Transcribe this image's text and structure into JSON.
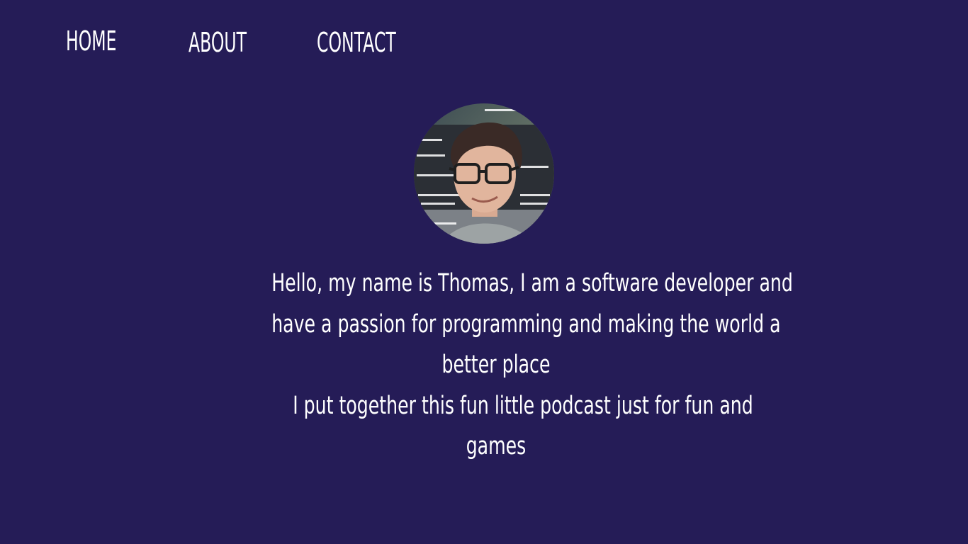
{
  "nav": {
    "items": [
      {
        "label": "HOME"
      },
      {
        "label": "ABOUT"
      },
      {
        "label": "CONTACT"
      }
    ]
  },
  "profile": {
    "photo_icon": "profile-photo",
    "bio_lines": [
      "Hello, my name is Thomas, I am a software developer and",
      "have a passion for programming and making the world a",
      "better place",
      "I put together this fun little podcast just for fun and",
      "games"
    ]
  },
  "colors": {
    "background": "#251c57",
    "text": "#ffffff"
  }
}
